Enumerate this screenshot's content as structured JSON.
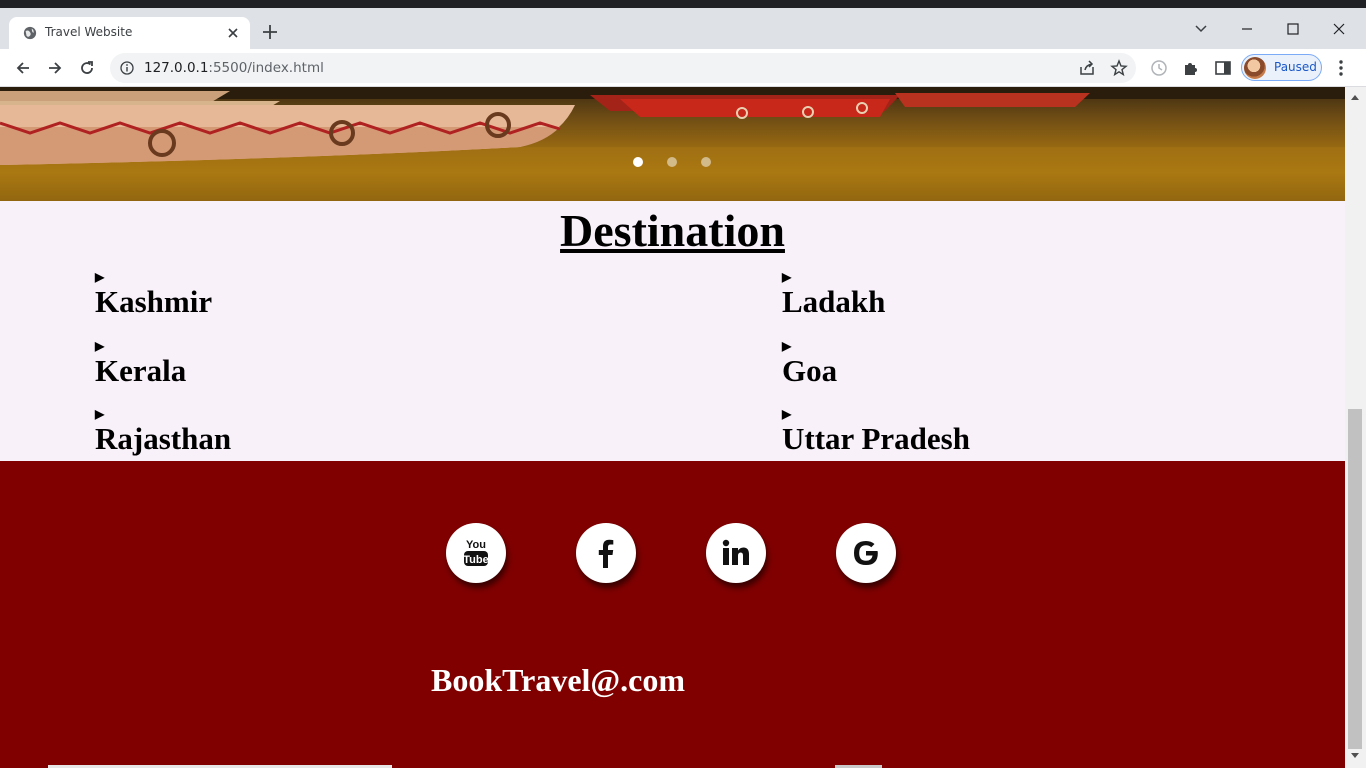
{
  "browser": {
    "tab_title": "Travel Website",
    "url_host": "127.0.0.1",
    "url_path": ":5500/index.html",
    "profile_label": "Paused"
  },
  "carousel": {
    "slide_count": 3,
    "active_slide": 1
  },
  "destinations": {
    "title": "Destination",
    "left": [
      "Kashmir",
      "Kerala",
      "Rajasthan"
    ],
    "right": [
      "Ladakh",
      "Goa",
      "Uttar Pradesh"
    ]
  },
  "footer": {
    "social": [
      {
        "icon": "youtube-icon",
        "label": "You Tube"
      },
      {
        "icon": "facebook-icon",
        "label": "f"
      },
      {
        "icon": "linkedin-icon",
        "label": "in"
      },
      {
        "icon": "google-icon",
        "label": "G"
      }
    ],
    "email": "BookTravel@.com",
    "background": "#800000"
  }
}
